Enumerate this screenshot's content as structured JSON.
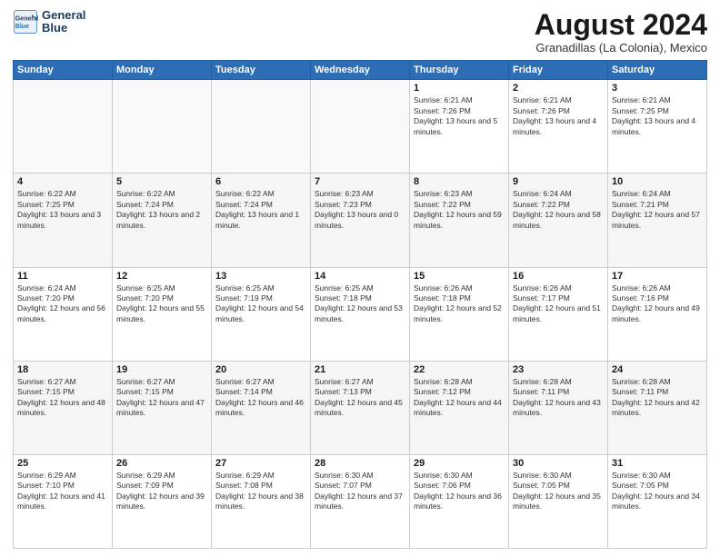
{
  "header": {
    "logo": {
      "line1": "General",
      "line2": "Blue"
    },
    "title": "August 2024",
    "subtitle": "Granadillas (La Colonia), Mexico"
  },
  "days_of_week": [
    "Sunday",
    "Monday",
    "Tuesday",
    "Wednesday",
    "Thursday",
    "Friday",
    "Saturday"
  ],
  "weeks": [
    [
      {
        "day": "",
        "empty": true
      },
      {
        "day": "",
        "empty": true
      },
      {
        "day": "",
        "empty": true
      },
      {
        "day": "",
        "empty": true
      },
      {
        "day": "1",
        "sunrise": "6:21 AM",
        "sunset": "7:26 PM",
        "daylight": "13 hours and 5 minutes."
      },
      {
        "day": "2",
        "sunrise": "6:21 AM",
        "sunset": "7:26 PM",
        "daylight": "13 hours and 4 minutes."
      },
      {
        "day": "3",
        "sunrise": "6:21 AM",
        "sunset": "7:25 PM",
        "daylight": "13 hours and 4 minutes."
      }
    ],
    [
      {
        "day": "4",
        "sunrise": "6:22 AM",
        "sunset": "7:25 PM",
        "daylight": "13 hours and 3 minutes."
      },
      {
        "day": "5",
        "sunrise": "6:22 AM",
        "sunset": "7:24 PM",
        "daylight": "13 hours and 2 minutes."
      },
      {
        "day": "6",
        "sunrise": "6:22 AM",
        "sunset": "7:24 PM",
        "daylight": "13 hours and 1 minute."
      },
      {
        "day": "7",
        "sunrise": "6:23 AM",
        "sunset": "7:23 PM",
        "daylight": "13 hours and 0 minutes."
      },
      {
        "day": "8",
        "sunrise": "6:23 AM",
        "sunset": "7:22 PM",
        "daylight": "12 hours and 59 minutes."
      },
      {
        "day": "9",
        "sunrise": "6:24 AM",
        "sunset": "7:22 PM",
        "daylight": "12 hours and 58 minutes."
      },
      {
        "day": "10",
        "sunrise": "6:24 AM",
        "sunset": "7:21 PM",
        "daylight": "12 hours and 57 minutes."
      }
    ],
    [
      {
        "day": "11",
        "sunrise": "6:24 AM",
        "sunset": "7:20 PM",
        "daylight": "12 hours and 56 minutes."
      },
      {
        "day": "12",
        "sunrise": "6:25 AM",
        "sunset": "7:20 PM",
        "daylight": "12 hours and 55 minutes."
      },
      {
        "day": "13",
        "sunrise": "6:25 AM",
        "sunset": "7:19 PM",
        "daylight": "12 hours and 54 minutes."
      },
      {
        "day": "14",
        "sunrise": "6:25 AM",
        "sunset": "7:18 PM",
        "daylight": "12 hours and 53 minutes."
      },
      {
        "day": "15",
        "sunrise": "6:26 AM",
        "sunset": "7:18 PM",
        "daylight": "12 hours and 52 minutes."
      },
      {
        "day": "16",
        "sunrise": "6:26 AM",
        "sunset": "7:17 PM",
        "daylight": "12 hours and 51 minutes."
      },
      {
        "day": "17",
        "sunrise": "6:26 AM",
        "sunset": "7:16 PM",
        "daylight": "12 hours and 49 minutes."
      }
    ],
    [
      {
        "day": "18",
        "sunrise": "6:27 AM",
        "sunset": "7:15 PM",
        "daylight": "12 hours and 48 minutes."
      },
      {
        "day": "19",
        "sunrise": "6:27 AM",
        "sunset": "7:15 PM",
        "daylight": "12 hours and 47 minutes."
      },
      {
        "day": "20",
        "sunrise": "6:27 AM",
        "sunset": "7:14 PM",
        "daylight": "12 hours and 46 minutes."
      },
      {
        "day": "21",
        "sunrise": "6:27 AM",
        "sunset": "7:13 PM",
        "daylight": "12 hours and 45 minutes."
      },
      {
        "day": "22",
        "sunrise": "6:28 AM",
        "sunset": "7:12 PM",
        "daylight": "12 hours and 44 minutes."
      },
      {
        "day": "23",
        "sunrise": "6:28 AM",
        "sunset": "7:11 PM",
        "daylight": "12 hours and 43 minutes."
      },
      {
        "day": "24",
        "sunrise": "6:28 AM",
        "sunset": "7:11 PM",
        "daylight": "12 hours and 42 minutes."
      }
    ],
    [
      {
        "day": "25",
        "sunrise": "6:29 AM",
        "sunset": "7:10 PM",
        "daylight": "12 hours and 41 minutes."
      },
      {
        "day": "26",
        "sunrise": "6:29 AM",
        "sunset": "7:09 PM",
        "daylight": "12 hours and 39 minutes."
      },
      {
        "day": "27",
        "sunrise": "6:29 AM",
        "sunset": "7:08 PM",
        "daylight": "12 hours and 38 minutes."
      },
      {
        "day": "28",
        "sunrise": "6:30 AM",
        "sunset": "7:07 PM",
        "daylight": "12 hours and 37 minutes."
      },
      {
        "day": "29",
        "sunrise": "6:30 AM",
        "sunset": "7:06 PM",
        "daylight": "12 hours and 36 minutes."
      },
      {
        "day": "30",
        "sunrise": "6:30 AM",
        "sunset": "7:05 PM",
        "daylight": "12 hours and 35 minutes."
      },
      {
        "day": "31",
        "sunrise": "6:30 AM",
        "sunset": "7:05 PM",
        "daylight": "12 hours and 34 minutes."
      }
    ]
  ]
}
